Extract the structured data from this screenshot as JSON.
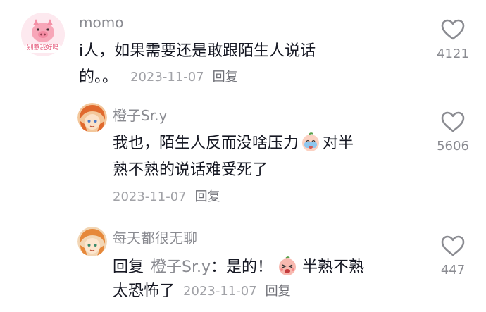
{
  "comments": [
    {
      "username": "momo",
      "avatar_caption": "别惹我好吗",
      "text_line1": "i人，如果需要还是敢跟陌生人说话",
      "text_line2": "的。。",
      "date": "2023-11-07",
      "reply_label": "回复",
      "likes": "4121",
      "avatar_icon": "pig-avatar-icon"
    },
    {
      "username": "橙子Sr.y",
      "text_line1_a": "我也，陌生人反而没啥压力",
      "text_line1_b": "对半",
      "text_line2": "熟不熟的说话难受死了",
      "date": "2023-11-07",
      "reply_label": "回复",
      "likes": "5606",
      "emoji": "crying-peach-emoji",
      "avatar_icon": "anime-girl-avatar-icon"
    },
    {
      "username": "每天都很无聊",
      "reply_prefix": "回复",
      "reply_target": "橙子Sr.y",
      "text_line1_a": "：是的！",
      "text_line1_b": "半熟不熟",
      "text_line2": "太恐怖了",
      "date": "2023-11-07",
      "reply_label": "回复",
      "likes": "447",
      "emoji": "scared-peach-emoji",
      "avatar_icon": "anime-girl-avatar-icon"
    }
  ],
  "colors": {
    "text": "#161823",
    "muted": "#8a8b91",
    "date": "#a1a2a7",
    "heart_outline": "#8a8b91"
  }
}
